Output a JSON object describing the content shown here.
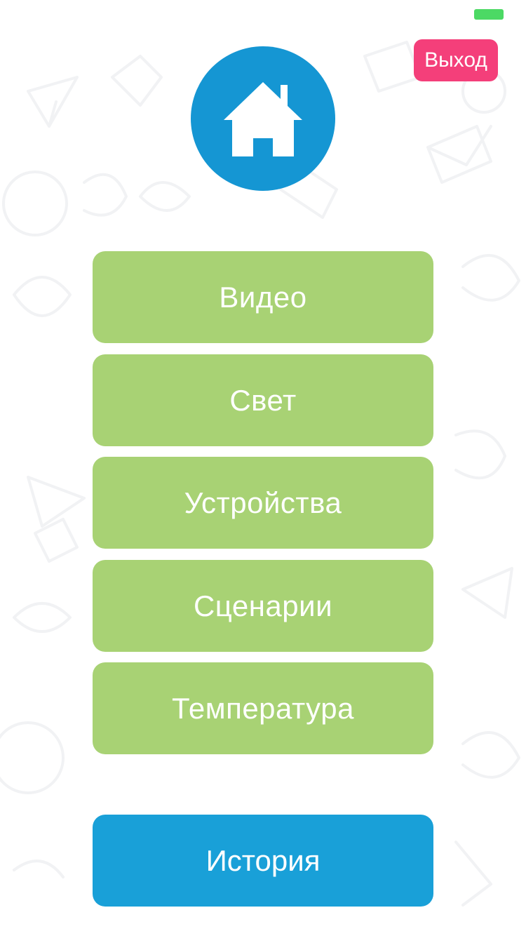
{
  "header": {
    "logout_label": "Выход",
    "logo_icon": "house-icon",
    "battery_color": "#4cd964"
  },
  "menu": {
    "items": [
      {
        "label": "Видео"
      },
      {
        "label": "Свет"
      },
      {
        "label": "Устройства"
      },
      {
        "label": "Сценарии"
      },
      {
        "label": "Температура"
      }
    ],
    "item_color": "#a8d274"
  },
  "footer": {
    "history_label": "История",
    "history_color": "#19a0d8"
  },
  "colors": {
    "logo_circle": "#1596d3",
    "logout_button": "#f43f7a"
  }
}
